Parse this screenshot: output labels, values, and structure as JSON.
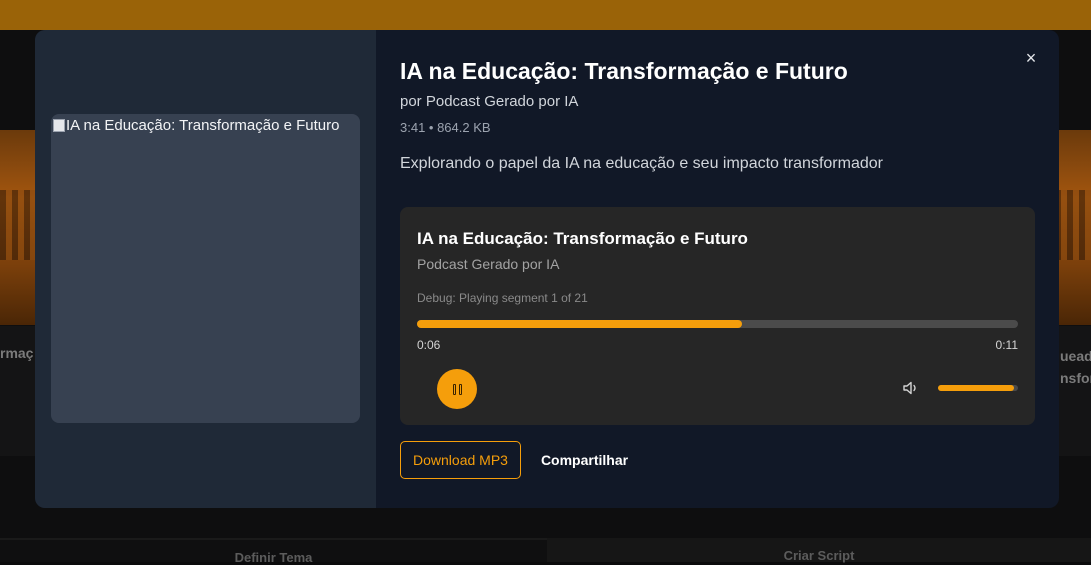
{
  "background": {
    "left_card_text": "rmaç",
    "right_card_text_line1": "uead",
    "right_card_text_line2": "nsfor",
    "tabs": [
      "Definir Tema",
      "Criar Script"
    ]
  },
  "modal": {
    "close_symbol": "×",
    "cover_alt": "IA na Educação: Transformação e Futuro",
    "title": "IA na Educação: Transformação e Futuro",
    "byline": "por Podcast Gerado por IA",
    "meta": "3:41 • 864.2 KB",
    "description": "Explorando o papel da IA na educação e seu impacto transformador",
    "player": {
      "title": "IA na Educação: Transformação e Futuro",
      "author": "Podcast Gerado por IA",
      "debug": "Debug: Playing segment 1 of 21",
      "progress_fraction": 0.54,
      "current_time": "0:06",
      "total_time": "0:11",
      "volume_fraction": 0.95,
      "state": "playing"
    },
    "actions": {
      "download_label": "Download MP3",
      "share_label": "Compartilhar"
    }
  },
  "colors": {
    "accent": "#f59e0b",
    "modal_bg": "#111827",
    "modal_left_bg": "#1f2937",
    "player_bg": "#262626"
  },
  "icons": {
    "close": "close-icon",
    "play_pause": "pause-icon",
    "volume": "volume-icon",
    "broken_image": "broken-image-icon"
  }
}
